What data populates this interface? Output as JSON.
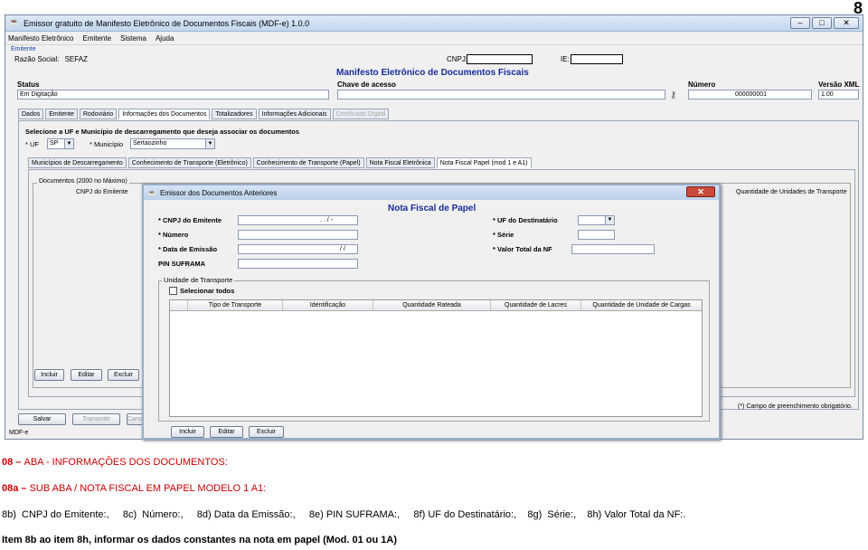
{
  "page_number": "8",
  "window": {
    "title": "Emissor gratuito de Manifesto Eletrônico de Documentos Fiscais (MDF-e) 1.0.0",
    "controls": [
      "–",
      "□",
      "✕"
    ]
  },
  "menu": [
    "Manifesto Eletrônico",
    "Emitente",
    "Sistema",
    "Ajuda"
  ],
  "emitente": {
    "label": "Emitente",
    "razao_social_label": "Razão Social:",
    "razao_social_value": "SEFAZ",
    "cnpj_label": "CNPJ:",
    "ie_label": "IE:"
  },
  "manifesto_title": "Manifesto Eletrônico de Documentos Fiscais",
  "header_fields": {
    "status_label": "Status",
    "status_value": "Em Digitação",
    "chave_label": "Chave de acesso",
    "numero_label": "Número",
    "numero_value": "000000001",
    "versao_label": "Versão XML",
    "versao_value": "1.00"
  },
  "main_tabs": [
    "Dados",
    "Emitente",
    "Rodoviário",
    "Informações dos Documentos",
    "Totalizadores",
    "Informações Adicionais",
    "Certificado Digital"
  ],
  "selecione_title": "Selecione a UF e Município de descarregamento que deseja associar os documentos",
  "uf_label": "* UF",
  "uf_value": "SP",
  "municipio_label": "* Município",
  "municipio_value": "Sertaozinho",
  "sub_tabs": [
    "Municípios de Descarregamento",
    "Conhecimento de Transporte (Eletrônico)",
    "Conhecimento de Transporte (Papel)",
    "Nota Fiscal Eletrônica",
    "Nota Fiscal Papel (mod 1 e A1)"
  ],
  "documents_legend": "Documentos (2000 no Máximo)",
  "doc_columns": [
    "CNPJ do Emitente",
    "Quantidade de Unidades de Transporte"
  ],
  "doc_buttons": [
    "Incluir",
    "Editar",
    "Excluir"
  ],
  "footer_buttons": [
    "Salvar",
    "Transmitir",
    "Cance"
  ],
  "footnote": "(*) Campo de preenchimento obrigatório.",
  "status_bar": "MDF-e",
  "dialog": {
    "title": "Emissor dos Documentos Anteriores",
    "subtitle": "Nota Fiscal de Papel",
    "cnpj_label": "* CNPJ do Emitente",
    "cnpj_mask": ".   .   /   -",
    "numero_label": "* Número",
    "data_label": "* Data de Emissão",
    "data_mask": "/   /",
    "pin_label": "PIN SUFRAMA",
    "uf_dest_label": "* UF do Destinatário",
    "serie_label": "* Série",
    "valor_label": "* Valor Total da NF",
    "ut_legend": "Unidade de Transporte",
    "select_all": "Selecionar todos",
    "grid_columns": [
      "Tipo de Transporte",
      "Identificação",
      "Quantidade Rateada",
      "Quantidade de Lacres",
      "Quantidade de Unidade de Cargas"
    ],
    "buttons": [
      "Incluir",
      "Editar",
      "Excluir"
    ]
  },
  "text": {
    "line1_num": "08",
    "line1_dash": " – ",
    "line1_rest": "ABA - INFORMAÇÕES DOS DOCUMENTOS:",
    "line2_num": "08a",
    "line2_dash": " – ",
    "line2_rest": "SUB ABA / NOTA FISCAL EM PAPEL MODELO 1 A1:",
    "line3": "8b)  CNPJ do Emitente:,     8c)  Número:,     8d) Data da Emissão:,     8e) PIN SUFRAMA:,     8f) UF do Destinatário:,    8g)  Série:,    8h) Valor Total da NF:.",
    "line4": "Item 8b ao item 8h, informar os dados constantes na nota em papel (Mod. 01 ou 1A)"
  }
}
